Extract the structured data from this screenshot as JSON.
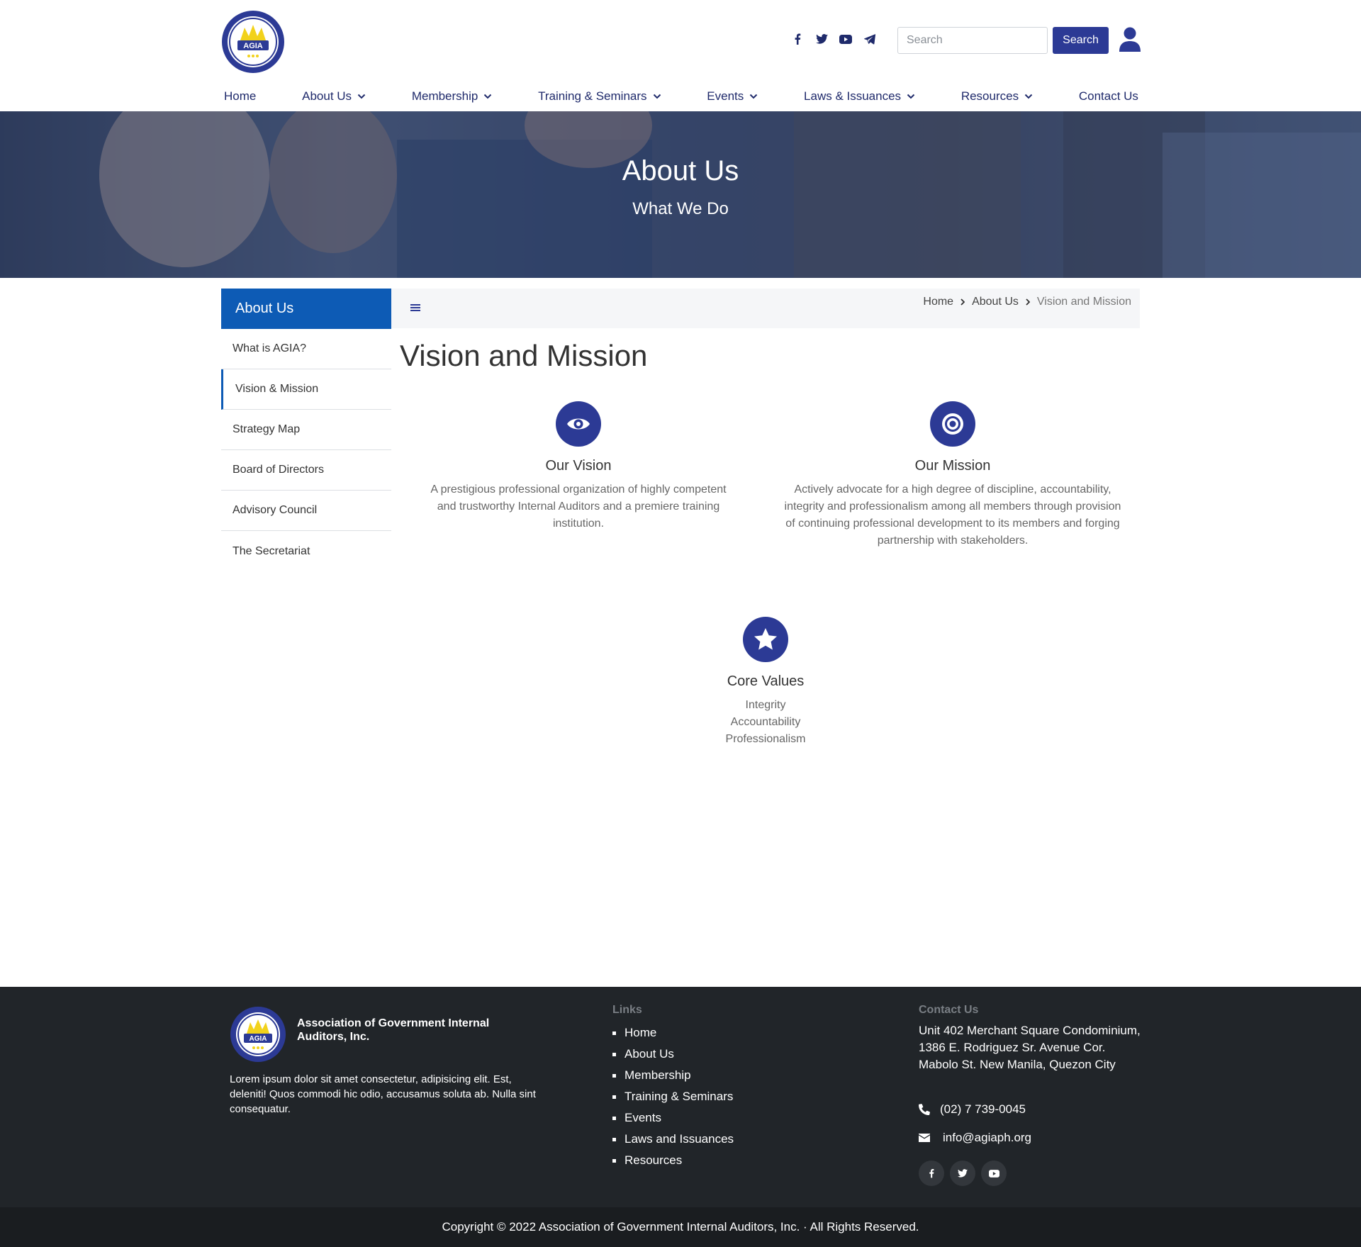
{
  "header": {
    "search_placeholder": "Search",
    "search_button": "Search",
    "social_icons": [
      "facebook-icon",
      "twitter-icon",
      "youtube-icon",
      "telegram-icon"
    ]
  },
  "nav": {
    "items": [
      {
        "label": "Home",
        "dropdown": false
      },
      {
        "label": "About Us",
        "dropdown": true
      },
      {
        "label": "Membership",
        "dropdown": true
      },
      {
        "label": "Training & Seminars",
        "dropdown": true
      },
      {
        "label": "Events",
        "dropdown": true
      },
      {
        "label": "Laws & Issuances",
        "dropdown": true
      },
      {
        "label": "Resources",
        "dropdown": true
      },
      {
        "label": "Contact Us",
        "dropdown": false
      }
    ]
  },
  "hero": {
    "title": "About Us",
    "subtitle": "What We Do"
  },
  "sidebar": {
    "heading": "About Us",
    "items": [
      {
        "label": "What is AGIA?",
        "active": false
      },
      {
        "label": "Vision & Mission",
        "active": true
      },
      {
        "label": "Strategy Map",
        "active": false
      },
      {
        "label": "Board of Directors",
        "active": false
      },
      {
        "label": "Advisory Council",
        "active": false
      },
      {
        "label": "The Secretariat",
        "active": false
      }
    ]
  },
  "breadcrumb": {
    "items": [
      "Home",
      "About Us"
    ],
    "current": "Vision and Mission"
  },
  "page": {
    "title": "Vision and Mission",
    "vision": {
      "title": "Our Vision",
      "body": "A prestigious professional organization of highly competent and trustworthy Internal Auditors and a premiere training institution."
    },
    "mission": {
      "title": "Our Mission",
      "body": "Actively advocate for a high degree of discipline, accountability, integrity and professionalism among all members through provision of continuing professional development to its members and forging partnership with stakeholders."
    },
    "values": {
      "title": "Core Values",
      "items": [
        "Integrity",
        "Accountability",
        "Professionalism"
      ]
    }
  },
  "footer": {
    "org_name": "Association of Government Internal Auditors, Inc.",
    "description": "Lorem ipsum dolor sit amet consectetur, adipisicing elit. Est, deleniti! Quos commodi hic odio, accusamus soluta ab. Nulla sint consequatur.",
    "links_title": "Links",
    "links": [
      "Home",
      "About Us",
      "Membership",
      "Training & Seminars",
      "Events",
      "Laws and Issuances",
      "Resources"
    ],
    "contact_title": "Contact Us",
    "address": "Unit 402 Merchant Square Condominium, 1386 E. Rodriguez Sr. Avenue Cor. Mabolo St. New Manila, Quezon City",
    "phone": "(02) 7 739-0045",
    "email": "info@agiaph.org",
    "copyright": "Copyright © 2022 Association of Government Internal Auditors, Inc. · All Rights Reserved."
  },
  "colors": {
    "brand": "#2c3a95",
    "sidebar_active": "#0d5bb5",
    "footer_bg": "#212529"
  }
}
